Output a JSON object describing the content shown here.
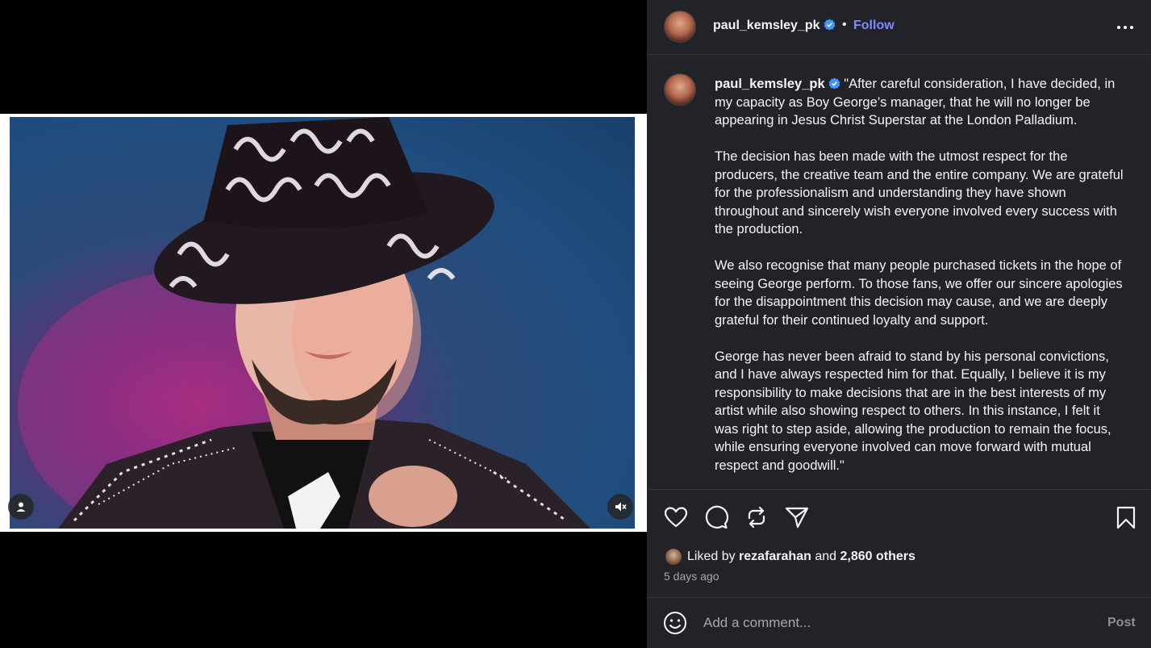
{
  "post": {
    "username": "paul_kemsley_pk",
    "header_separator": "•",
    "follow_label": "Follow",
    "caption": {
      "username": "paul_kemsley_pk",
      "paragraphs": [
        "\"After careful consideration, I have decided, in my capacity as Boy George’s manager, that he will no longer be appearing in Jesus Christ Superstar at the London Palladium.",
        "The decision has been made with the utmost respect for the producers, the creative team and the entire company. We are grateful for the professionalism and understanding they have shown throughout and sincerely wish everyone involved every success with the production.",
        "We also recognise that many people purchased tickets in the hope of seeing George perform. To those fans, we offer our sincere apologies for the disappointment this decision may cause, and we are deeply grateful for their continued loyalty and support.",
        "George has never been afraid to stand by his personal convictions, and I have always respected him for that. Equally, I believe it is my responsibility to make decisions that are in the best interests of my artist while also showing respect to others. In this instance, I felt it was right to step aside, allowing the production to remain the focus, while ensuring everyone involved can move forward with mutual respect and goodwill.\""
      ]
    },
    "likes": {
      "prefix": "Liked by",
      "user": "rezafarahan",
      "joiner": "and",
      "others": "2,860 others"
    },
    "timestamp": "5 days ago"
  },
  "comment_box": {
    "placeholder": "Add a comment...",
    "post_label": "Post"
  },
  "icons": {
    "more": "more-horizontal-icon",
    "verified": "verified-badge-icon",
    "like": "heart-icon",
    "comment": "comment-icon",
    "repost": "repost-icon",
    "share": "send-icon",
    "save": "bookmark-icon",
    "emoji": "emoji-icon",
    "user_tag": "user-icon",
    "mute": "muted-speaker-icon"
  },
  "colors": {
    "panel_bg": "#212328",
    "accent_link": "#7c8bff",
    "verified_blue": "#4496ff",
    "secondary_text": "#a8a8a8"
  }
}
